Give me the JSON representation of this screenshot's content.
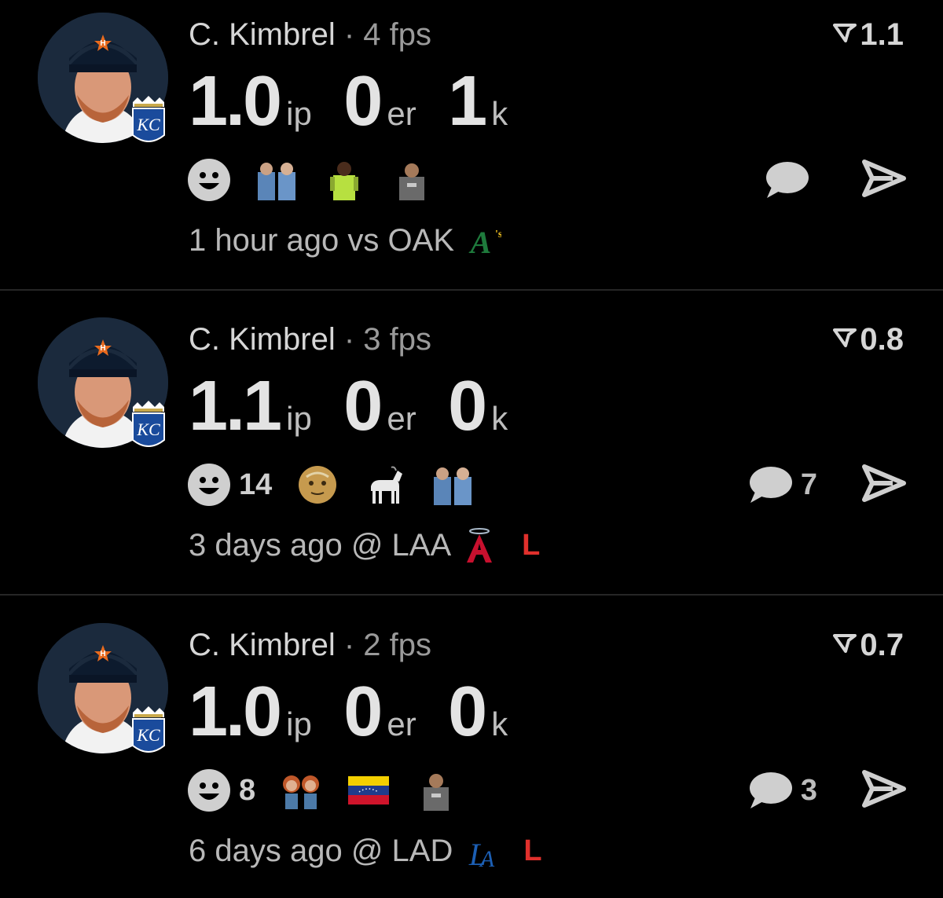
{
  "cards": [
    {
      "player": "C. Kimbrel",
      "sep": "·",
      "fps": "4 fps",
      "score": "1.1",
      "stats": [
        {
          "value": "1.0",
          "unit": "ip"
        },
        {
          "value": "0",
          "unit": "er"
        },
        {
          "value": "1",
          "unit": "k"
        }
      ],
      "reaction_count": "",
      "reaction_emojis": [
        "two-players-emoji",
        "goalkeeper-emoji",
        "man-pointing-emoji"
      ],
      "comment_count": "",
      "time": "1 hour ago",
      "venue": "vs OAK",
      "opponent_logo": "athletics-logo",
      "result": ""
    },
    {
      "player": "C. Kimbrel",
      "sep": "·",
      "fps": "3 fps",
      "score": "0.8",
      "stats": [
        {
          "value": "1.1",
          "unit": "ip"
        },
        {
          "value": "0",
          "unit": "er"
        },
        {
          "value": "0",
          "unit": "k"
        }
      ],
      "reaction_count": "14",
      "reaction_emojis": [
        "old-man-emoji",
        "goat-emoji",
        "two-players-emoji"
      ],
      "comment_count": "7",
      "time": "3 days ago",
      "venue": "@ LAA",
      "opponent_logo": "angels-logo",
      "result": "L"
    },
    {
      "player": "C. Kimbrel",
      "sep": "·",
      "fps": "2 fps",
      "score": "0.7",
      "stats": [
        {
          "value": "1.0",
          "unit": "ip"
        },
        {
          "value": "0",
          "unit": "er"
        },
        {
          "value": "0",
          "unit": "k"
        }
      ],
      "reaction_count": "8",
      "reaction_emojis": [
        "chucky-dolls-emoji",
        "venezuela-flag-emoji",
        "man-pointing-emoji"
      ],
      "comment_count": "3",
      "time": "6 days ago",
      "venue": "@ LAD",
      "opponent_logo": "dodgers-logo",
      "result": "L"
    }
  ],
  "colors": {
    "background": "#000000",
    "result_loss": "#e0302c",
    "text_primary": "#e3e3e3",
    "text_secondary": "#9a9a9a"
  }
}
